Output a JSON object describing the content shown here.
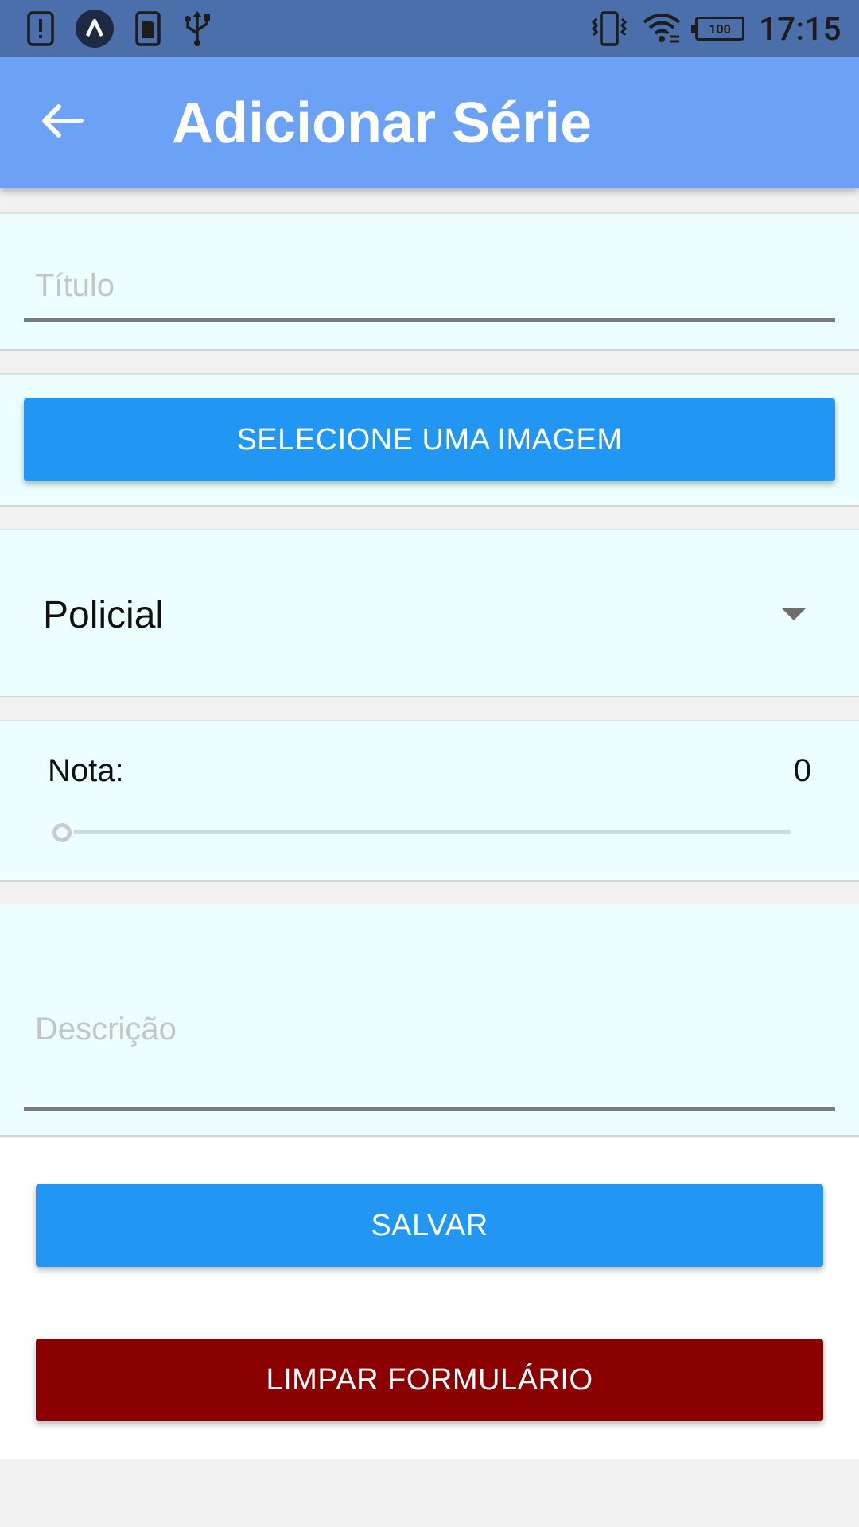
{
  "status_bar": {
    "time": "17:15",
    "battery_level": "100",
    "icons": [
      "alert-icon",
      "a-app-icon",
      "sd-card-icon",
      "usb-icon",
      "vibrate-icon",
      "wifi-icon",
      "battery-icon"
    ]
  },
  "app_bar": {
    "title": "Adicionar Série",
    "back_icon": "arrow-left-icon"
  },
  "form": {
    "title_placeholder": "Título",
    "title_value": "",
    "select_image_label": "SELECIONE UMA IMAGEM",
    "genre_selected": "Policial",
    "genre_dropdown_icon": "caret-down-icon",
    "rating_label": "Nota:",
    "rating_value": "0",
    "rating_fraction": 0,
    "description_placeholder": "Descrição",
    "description_value": ""
  },
  "actions": {
    "save_label": "SALVAR",
    "clear_label": "LIMPAR FORMULÁRIO"
  },
  "colors": {
    "status_bar": "#4b6faa",
    "app_bar": "#6ba2f6",
    "card_bg": "#ecfefe",
    "primary_button": "#2196f3",
    "danger_button": "#8b0000"
  }
}
